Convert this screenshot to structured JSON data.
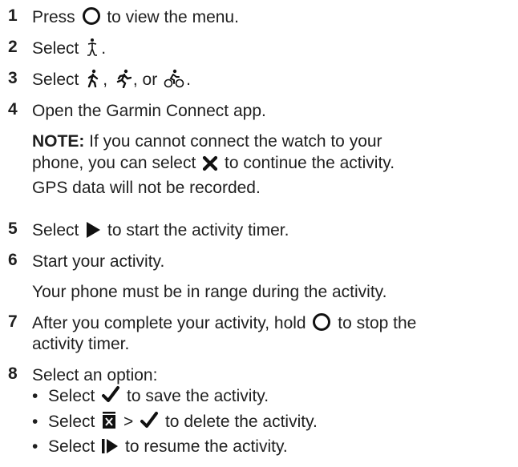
{
  "steps": [
    {
      "num": "1",
      "pre": "Press ",
      "post": " to view the menu.",
      "icon": "circle-button-icon"
    },
    {
      "num": "2",
      "pre": "Select ",
      "post": ".",
      "icon": "standing-figure-icon"
    },
    {
      "num": "3",
      "pre": "Select ",
      "mid1": ", ",
      "mid2": ", or ",
      "post": ".",
      "icons": [
        "walk-icon",
        "run-icon",
        "bike-icon"
      ]
    },
    {
      "num": "4",
      "text": "Open the Garmin Connect app.",
      "note_label": "NOTE:",
      "note_line1": " If you cannot connect the watch to your",
      "note_line2_pre": "phone, you can select ",
      "note_line2_post": " to continue the activity.",
      "note_line3": "GPS data will not be recorded.",
      "note_icon": "x-icon"
    },
    {
      "num": "5",
      "pre": "Select ",
      "post": " to start the activity timer.",
      "icon": "play-icon"
    },
    {
      "num": "6",
      "text": "Start your activity.",
      "sub": "Your phone must be in range during the activity."
    },
    {
      "num": "7",
      "pre": "After you complete your activity, hold ",
      "post": " to stop the",
      "line2": "activity timer.",
      "icon": "circle-button-icon"
    },
    {
      "num": "8",
      "text": "Select an option:",
      "options": [
        {
          "pre": "Select ",
          "post": " to save the activity.",
          "icon": "check-icon"
        },
        {
          "pre": "Select ",
          "mid": " > ",
          "post": " to delete the activity.",
          "icons": [
            "trash-icon",
            "check-icon"
          ]
        },
        {
          "pre": "Select ",
          "post": " to resume the activity.",
          "icon": "resume-icon"
        }
      ]
    }
  ],
  "bullet_char": "•"
}
